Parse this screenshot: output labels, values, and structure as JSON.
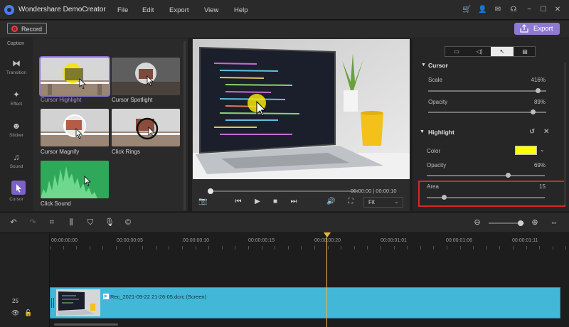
{
  "app": {
    "title": "Wondershare DemoCreator",
    "menus": [
      "File",
      "Edit",
      "Export",
      "View",
      "Help"
    ]
  },
  "recordbar": {
    "record_label": "Record",
    "export_label": "Export"
  },
  "sidebar": {
    "caption_label": "Caption",
    "items": [
      {
        "label": "Transition",
        "icon": "transition-icon"
      },
      {
        "label": "Effect",
        "icon": "effect-icon"
      },
      {
        "label": "Sticker",
        "icon": "sticker-icon"
      },
      {
        "label": "Sound",
        "icon": "sound-icon"
      },
      {
        "label": "Cursor",
        "icon": "cursor-icon"
      }
    ]
  },
  "effects": {
    "items": [
      {
        "label": "Cursor Highlight",
        "selected": true
      },
      {
        "label": "Cursor Spotlight",
        "selected": false
      },
      {
        "label": "Cursor Magnify",
        "selected": false
      },
      {
        "label": "Click Rings",
        "selected": false
      },
      {
        "label": "Click Sound",
        "selected": false
      }
    ]
  },
  "preview": {
    "timecode": "00:00:00 | 00:00:10",
    "fit_label": "Fit",
    "progress": 0.03
  },
  "properties": {
    "cursor_section": "Cursor",
    "scale_label": "Scale",
    "scale_value": "416%",
    "scale_level": 0.93,
    "opacity_label": "Opacity",
    "opacity_value": "89%",
    "opacity_level": 0.89,
    "highlight_section": "Highlight",
    "color_label": "Color",
    "color_value": "#ffff00",
    "h_opacity_label": "Opacity",
    "h_opacity_value": "69%",
    "h_opacity_level": 0.69,
    "area_label": "Area",
    "area_value": "15",
    "area_level": 0.15
  },
  "timeline": {
    "ticks": [
      "00:00:00:00",
      "00:00:00:05",
      "00:00:00:10",
      "00:00:00:15",
      "00:00:00:20",
      "00:00:01:01",
      "00:00:01:06",
      "00:00:01:11"
    ],
    "track_number": "25",
    "clip_label": "Rec_2021-09-22 21-26-05.dcrc (Screen)"
  },
  "colors": {
    "accent": "#8e7ad1",
    "clip": "#43b7d8",
    "playhead": "#e8b44a",
    "record": "#e84141",
    "highlight_box": "#d62828"
  }
}
